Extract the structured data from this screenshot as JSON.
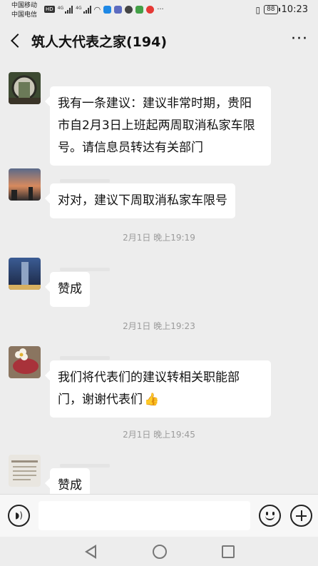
{
  "status_bar": {
    "carrier_1": "中国移动",
    "carrier_2": "中国电信",
    "hd_badge": "HD",
    "network_1": "4G",
    "network_2": "4G",
    "battery": "88",
    "time": "10:23"
  },
  "header": {
    "title": "筑人大代表之家(194)",
    "more_label": "···"
  },
  "messages": [
    {
      "text": "我有一条建议：建议非常时期，贵阳市自2月3日上班起两周取消私家车限号。请信息员转达有关部门"
    },
    {
      "text": "对对，建议下周取消私家车限号"
    },
    {
      "text": "赞成"
    },
    {
      "text": "我们将代表们的建议转相关职能部门，谢谢代表们",
      "emoji": "👍"
    },
    {
      "text": "赞成"
    }
  ],
  "timestamps": [
    "2月1日 晚上19:19",
    "2月1日 晚上19:23",
    "2月1日 晚上19:45"
  ],
  "input_bar": {
    "placeholder": ""
  },
  "colors": {
    "background": "#ededed",
    "bubble": "#ffffff",
    "timestamp": "#9b9b9b"
  }
}
